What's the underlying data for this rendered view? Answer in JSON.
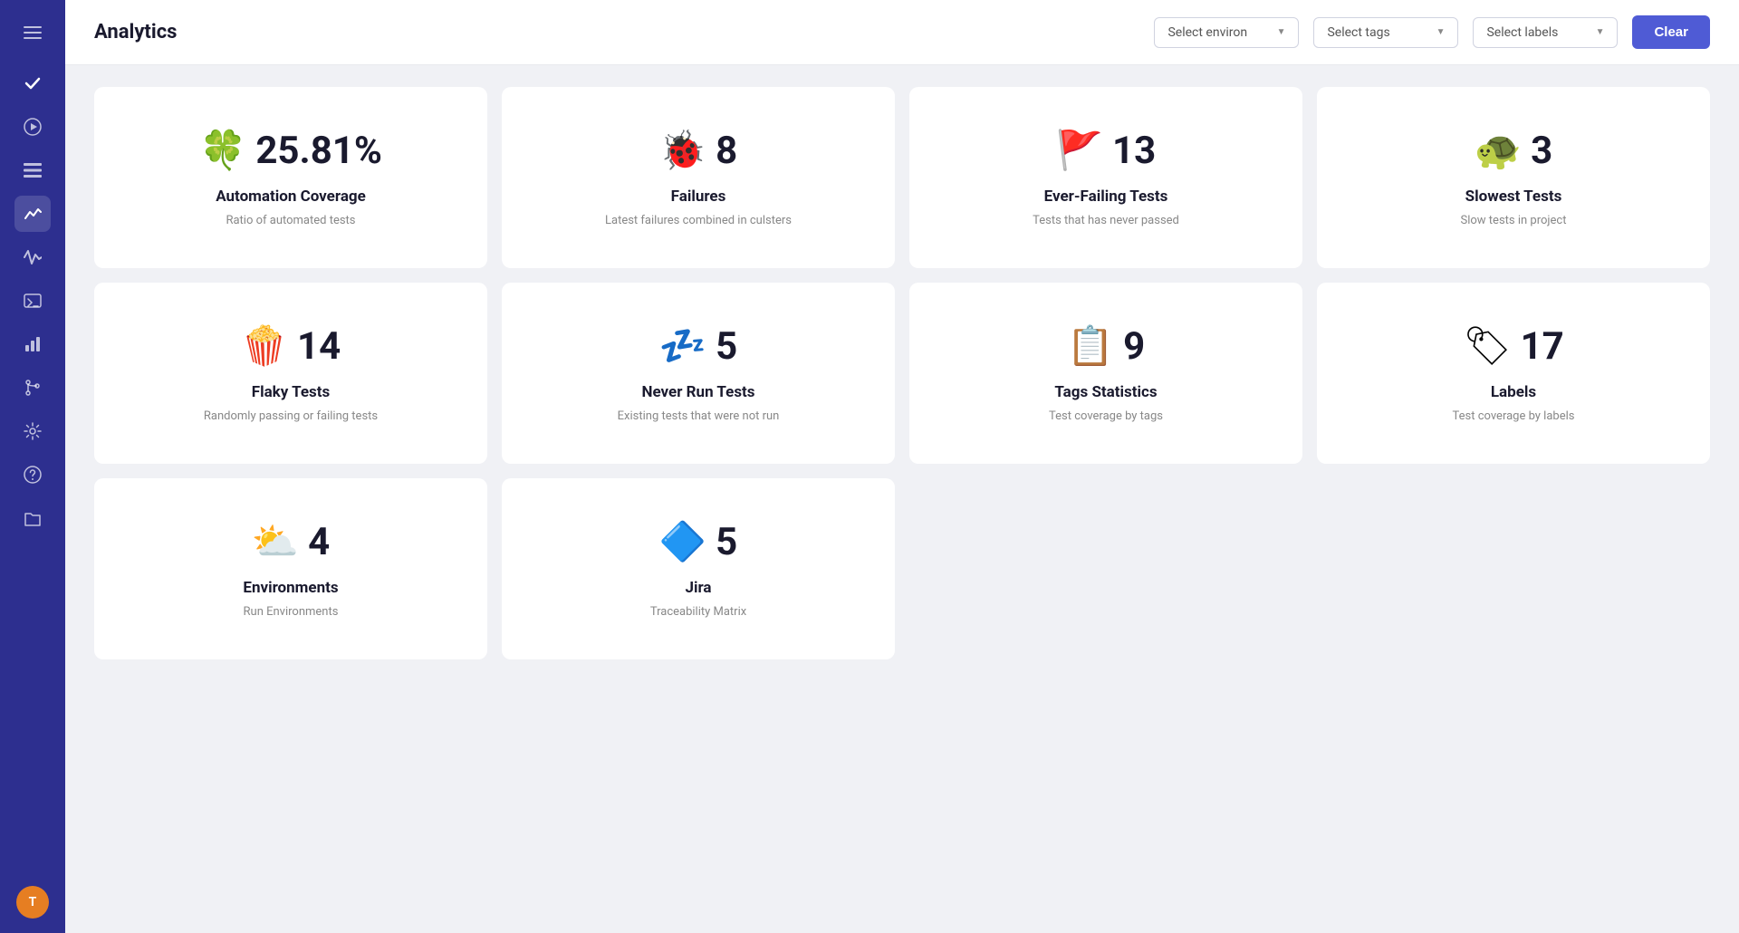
{
  "sidebar": {
    "items": [
      {
        "name": "hamburger-menu",
        "icon": "☰",
        "active": false
      },
      {
        "name": "check-icon",
        "icon": "✓",
        "active": false
      },
      {
        "name": "play-icon",
        "icon": "▶",
        "active": false
      },
      {
        "name": "list-icon",
        "icon": "≡",
        "active": false
      },
      {
        "name": "analytics-icon",
        "icon": "📈",
        "active": true
      },
      {
        "name": "activity-icon",
        "icon": "〰",
        "active": false
      },
      {
        "name": "terminal-icon",
        "icon": "⊡",
        "active": false
      },
      {
        "name": "chart-icon",
        "icon": "▦",
        "active": false
      },
      {
        "name": "branch-icon",
        "icon": "⌥",
        "active": false
      },
      {
        "name": "settings-icon",
        "icon": "⚙",
        "active": false
      },
      {
        "name": "help-icon",
        "icon": "?",
        "active": false
      },
      {
        "name": "folder-icon",
        "icon": "🗂",
        "active": false
      }
    ],
    "avatar": {
      "label": "T"
    }
  },
  "header": {
    "title": "Analytics",
    "filters": {
      "environment": {
        "label": "Select environ",
        "placeholder": "Select environ"
      },
      "tags": {
        "label": "Select tags",
        "placeholder": "Select tags"
      },
      "labels": {
        "label": "Select labels",
        "placeholder": "Select labels"
      }
    },
    "clear_button": "Clear"
  },
  "cards": [
    {
      "emoji": "🍀",
      "value": "25.81%",
      "title": "Automation Coverage",
      "description": "Ratio of automated tests"
    },
    {
      "emoji": "🐞",
      "value": "8",
      "title": "Failures",
      "description": "Latest failures combined in culsters"
    },
    {
      "emoji": "🚩",
      "value": "13",
      "title": "Ever-Failing Tests",
      "description": "Tests that has never passed"
    },
    {
      "emoji": "🐢",
      "value": "3",
      "title": "Slowest Tests",
      "description": "Slow tests in project"
    },
    {
      "emoji": "🍿",
      "value": "14",
      "title": "Flaky Tests",
      "description": "Randomly passing or failing tests"
    },
    {
      "emoji": "💤",
      "value": "5",
      "title": "Never Run Tests",
      "description": "Existing tests that were not run"
    },
    {
      "emoji": "📋",
      "value": "9",
      "title": "Tags Statistics",
      "description": "Test coverage by tags"
    },
    {
      "emoji": "🏷",
      "value": "17",
      "title": "Labels",
      "description": "Test coverage by labels"
    },
    {
      "emoji": "⛅",
      "value": "4",
      "title": "Environments",
      "description": "Run Environments"
    },
    {
      "emoji": "🔷",
      "value": "5",
      "title": "Jira",
      "description": "Traceability Matrix"
    }
  ]
}
